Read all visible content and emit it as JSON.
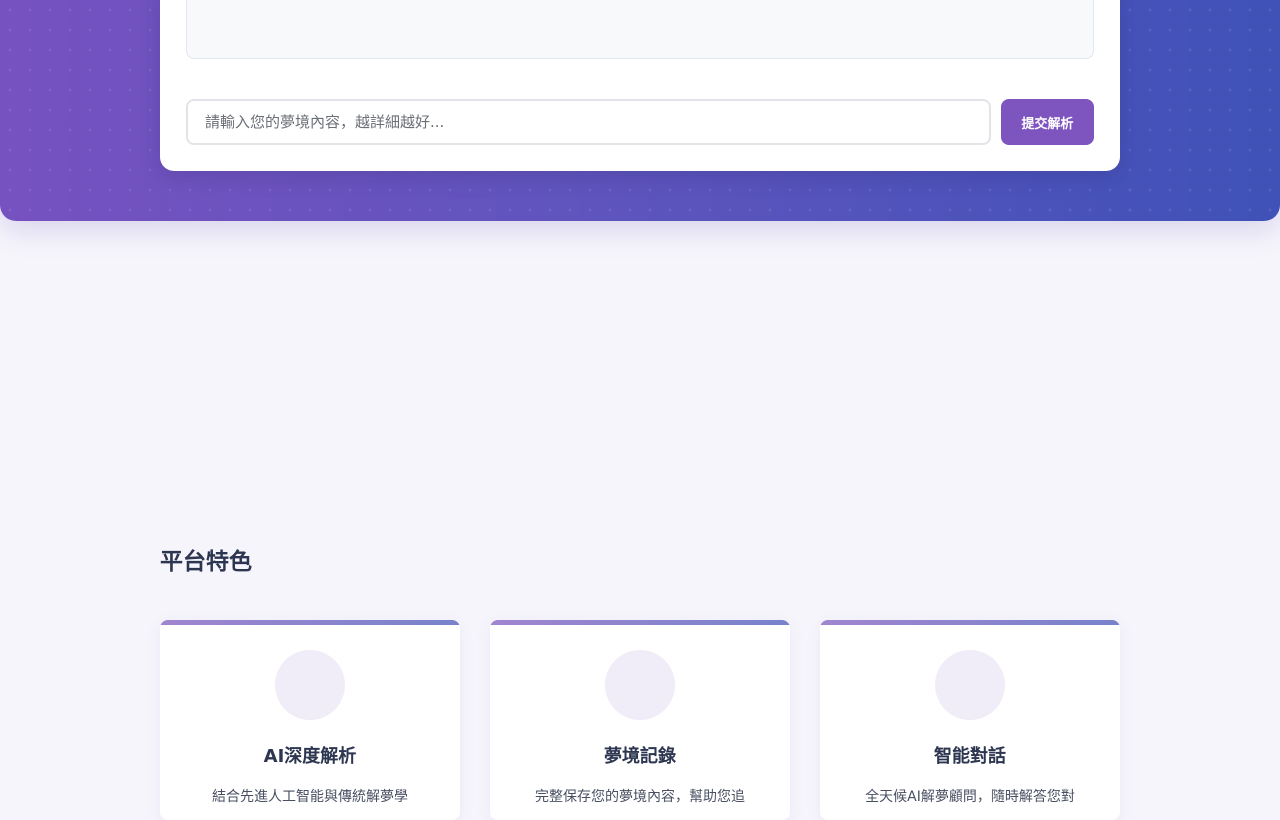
{
  "chat": {
    "input_placeholder": "請輸入您的夢境內容，越詳細越好...",
    "submit_label": "提交解析"
  },
  "features": {
    "section_title": "平台特色",
    "items": [
      {
        "icon": "feature-icon",
        "title": "AI深度解析",
        "desc": "結合先進人工智能與傳統解夢學"
      },
      {
        "icon": "feature-icon",
        "title": "夢境記錄",
        "desc": "完整保存您的夢境內容，幫助您追"
      },
      {
        "icon": "feature-icon",
        "title": "智能對話",
        "desc": "全天候AI解夢顧問，隨時解答您對"
      }
    ]
  },
  "colors": {
    "hero_start": "#7652c0",
    "hero_end": "#3f52b8",
    "accent": "#7e54bf",
    "page_bg": "#f6f5fb"
  }
}
